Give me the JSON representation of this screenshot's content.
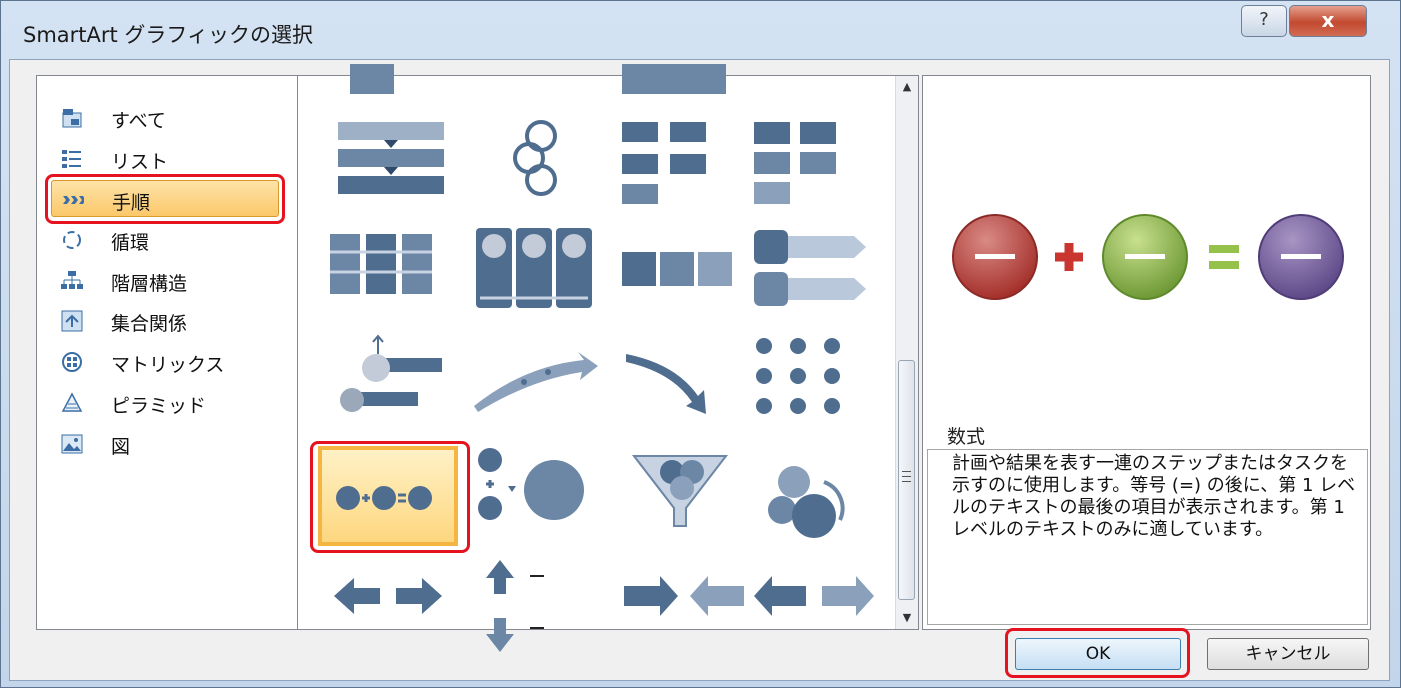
{
  "window": {
    "title": "SmartArt グラフィックの選択",
    "help_glyph": "?",
    "close_glyph": "x"
  },
  "categories": [
    {
      "label": "すべて",
      "icon": "all-icon"
    },
    {
      "label": "リスト",
      "icon": "list-icon"
    },
    {
      "label": "手順",
      "icon": "process-icon",
      "selected": true
    },
    {
      "label": "循環",
      "icon": "cycle-icon"
    },
    {
      "label": "階層構造",
      "icon": "hierarchy-icon"
    },
    {
      "label": "集合関係",
      "icon": "relationship-icon"
    },
    {
      "label": "マトリックス",
      "icon": "matrix-icon"
    },
    {
      "label": "ピラミッド",
      "icon": "pyramid-icon"
    },
    {
      "label": "図",
      "icon": "picture-icon"
    }
  ],
  "gallery": {
    "selected_item": "equation-thumbnail"
  },
  "preview": {
    "name": "数式",
    "description": "計画や結果を表す一連のステップまたはタスクを示すのに使用します。等号 (=) の後に、第 1 レベルのテキストの最後の項目が表示されます。第 1 レベルのテキストのみに適しています。"
  },
  "buttons": {
    "ok": "OK",
    "cancel": "キャンセル"
  },
  "colors": {
    "highlight": "#e5131f",
    "selection": "#fbc86a",
    "shape_blue": "#4f6d8f"
  }
}
